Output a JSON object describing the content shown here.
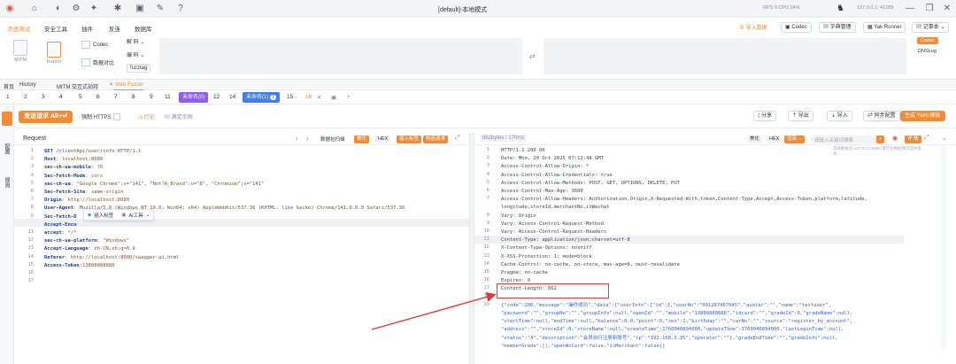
{
  "window": {
    "title": "[default]-本地模式",
    "stats": "RPS 0  CPU 24%",
    "host": "127.0.0.1: 41289",
    "account": "记事本"
  },
  "menu": {
    "items": [
      "渗透测试",
      "安全工具",
      "插件",
      "反连",
      "数据库"
    ],
    "tools": [
      {
        "name": "mitm",
        "label": "MITM"
      },
      {
        "name": "fuzzer",
        "label": "Fuzzer"
      },
      {
        "name": "codec",
        "label": "Codec"
      },
      {
        "name": "compare",
        "label": "数据对比"
      }
    ],
    "decode_label": "解 码",
    "encode_label": "编 码",
    "fuzztag_label": "fuzztag",
    "right_buttons": [
      "导入数据",
      "Codec",
      "字典管理",
      "Yak Runner"
    ],
    "codec_badge": "Codec",
    "dnslog": "DNSLog"
  },
  "page_tabs": [
    "首页",
    "History",
    "MITM 交互式劫持",
    "Web Fuzzer"
  ],
  "fuzzer_tabs": {
    "numbers": [
      "1",
      "2",
      "3",
      "4",
      "5",
      "6",
      "7",
      "8",
      "9",
      "11"
    ],
    "group_a": "未命名(0)",
    "numbers_b": [
      "12",
      "14"
    ],
    "group_b": "未命名(1)",
    "group_b_count": "1",
    "numbers_c": [
      "15",
      "16"
    ]
  },
  "sidebar": {
    "a": "配置",
    "b": "规则"
  },
  "actions": {
    "send": "发送请求 Alt+⏎",
    "https": "强制 HTTPS",
    "history": "历史",
    "example": "满足示例",
    "share": "分享",
    "export": "导出",
    "import": "导入",
    "sync": "同步配置",
    "gen_yaml": "生成 Yaml 模板"
  },
  "request": {
    "title": "Request",
    "packet_ops": "数据包扫描",
    "btn_beautify": "美化",
    "btn_hex": "HEX",
    "btn_insert_tag": "插入标签",
    "btn_chunk": "构造请求",
    "float_insert": "插入标签",
    "float_ai": "AI工具",
    "lines": [
      {
        "n": "1",
        "k": "GET",
        "v": " /clientApi/user/info HTTP/1.1"
      },
      {
        "n": "2",
        "k": "Host",
        "v": ": localhost:8080"
      },
      {
        "n": "3",
        "k": "sec-ch-ua-mobile",
        "v": ": ?0"
      },
      {
        "n": "4",
        "k": "Sec-Fetch-Mode",
        "v": ": cors"
      },
      {
        "n": "5",
        "k": "sec-ch-ua",
        "v": ": \"Google Chrome\";v=\"141\", \"Not?A_Brand\";v=\"8\", \"Chromium\";v=\"141\""
      },
      {
        "n": "6",
        "k": "Sec-Fetch-Site",
        "v": ": same-origin"
      },
      {
        "n": "7",
        "k": "Origin",
        "v": ": http://localhost:8080"
      },
      {
        "n": "8",
        "k": "User-Agent",
        "v": ": Mozilla/5.0 (Windows NT 10.0; Win64; x64) AppleWebKit/537.36 (KHTML, like Gecko) Chrome/141.0.0.0 Safari/537.36"
      },
      {
        "n": "9",
        "k": "Sec-Fetch-D",
        "v": ""
      },
      {
        "n": "10",
        "k": "Accept-Enco",
        "v": ""
      },
      {
        "n": "11",
        "k": "accept",
        "v": ": */*"
      },
      {
        "n": "12",
        "k": "sec-ch-ua-platform",
        "v": ": \"Windows\""
      },
      {
        "n": "13",
        "k": "Accept-Language",
        "v": ": zh-CN,zh;q=0.9"
      },
      {
        "n": "14",
        "k": "Referer",
        "v": ": http://localhost:8080/swagger-ui.html"
      },
      {
        "n": "15",
        "k": "Access-Token",
        "v": ":13888888888"
      },
      {
        "n": "16",
        "k": "",
        "v": ""
      },
      {
        "n": "17",
        "k": "",
        "v": ""
      }
    ]
  },
  "response": {
    "size": "662bytes / 170ms",
    "btn_beautify": "美化",
    "btn_hex": "HEX",
    "btn_render": "渲染",
    "search_placeholder": "请输入关键词搜索",
    "btn_detail": "详 情",
    "side_note": "选择数据包 127.0.0.1:8080 请在左侧右侧可选中高亮... ",
    "lines": [
      {
        "n": "1",
        "t": "HTTP/1.1 200 OK"
      },
      {
        "n": "2",
        "t": "Date: Mon, 20 Oct 2025 07:12:48 GMT"
      },
      {
        "n": "3",
        "t": "Access-Control-Allow-Origin: *"
      },
      {
        "n": "4",
        "t": "Access-Control-Allow-Credentials: true"
      },
      {
        "n": "5",
        "t": "Access-Control-Allow-Methods: POST, GET, OPTIONS, DELETE, PUT"
      },
      {
        "n": "6",
        "t": "Access-Control-Max-Age: 3600"
      },
      {
        "n": "7",
        "t": "Access-Control-Allow-Headers: Authorization,Origin,X-Requested-With,token,Content-Type,Accept,Access-Token,platform,latitude,"
      },
      {
        "n": "",
        "t": "longitude,storeId,merchantNo,isWechat"
      },
      {
        "n": "8",
        "t": "Vary: Origin"
      },
      {
        "n": "9",
        "t": "Vary: Access-Control-Request-Method"
      },
      {
        "n": "10",
        "t": "Vary: Access-Control-Request-Headers"
      },
      {
        "n": "11",
        "t": "Content-Type: application/json;charset=utf-8"
      },
      {
        "n": "12",
        "t": "X-Content-Type-Options: nosniff"
      },
      {
        "n": "13",
        "t": "X-XSS-Protection: 1; mode=block"
      },
      {
        "n": "14",
        "t": "Cache-Control: no-cache, no-store, max-age=0, must-revalidate"
      },
      {
        "n": "15",
        "t": "Pragma: no-cache"
      },
      {
        "n": "16",
        "t": "Expires: 0"
      },
      {
        "n": "17",
        "t": "Content-Length: 662"
      },
      {
        "n": "18",
        "t": ""
      },
      {
        "n": "19",
        "t": "{\"code\":200,\"message\":\"操作成功\",\"data\":{\"userInfo\":{\"id\":3,\"userNo\":\"001287467045\",\"avatar\":\"\",\"name\":\"testuser\","
      },
      {
        "n": "",
        "t": "\"password\":\"\",\"groupNo\":\"\",\"groupInfo\":null,\"openId\":\"\",\"mobile\":\"13888888888\",\"idcard\":\"\",\"gradeId\":0,\"gradeName\":null,"
      },
      {
        "n": "",
        "t": "\"startTime\":null,\"endTime\":null,\"balance\":0.0,\"point\":0,\"sex\":1,\"birthday\":\"\",\"carNo\":\"\",\"source\":\"register_by_account\","
      },
      {
        "n": "",
        "t": "\"address\":\"\",\"storeId\":0,\"storeName\":null,\"createTime\":1760940894000,\"updateTime\":1760940894000,\"lastLoginTime\":null,"
      },
      {
        "n": "",
        "t": "\"status\":\"A\",\"description\":\"会员自行注册新账号\",\"ip\":\"192.168.3.35\",\"operator\":\"\"},\"gradeEndTime\":\"\",\"gradeInfo\":null,"
      },
      {
        "n": "",
        "t": "\"memberGrade\":[],\"openWxCard\":false,\"isMerchant\":false}}"
      }
    ]
  }
}
